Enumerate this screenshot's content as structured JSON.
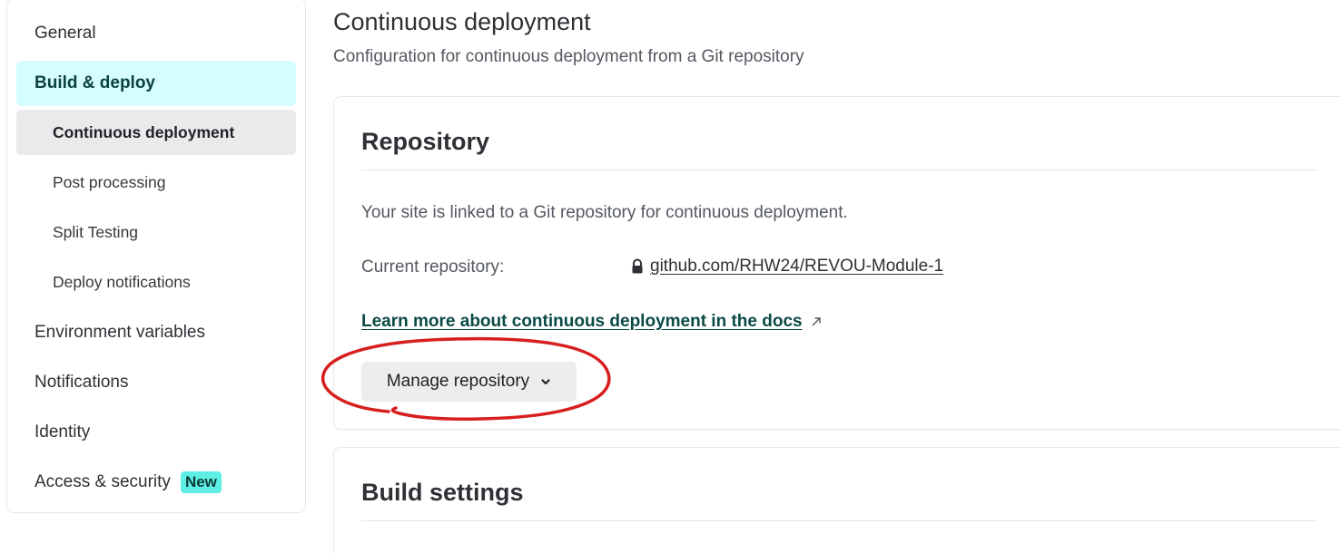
{
  "sidebar": {
    "items": [
      {
        "label": "General"
      },
      {
        "label": "Build & deploy"
      },
      {
        "label": "Continuous deployment"
      },
      {
        "label": "Post processing"
      },
      {
        "label": "Split Testing"
      },
      {
        "label": "Deploy notifications"
      },
      {
        "label": "Environment variables"
      },
      {
        "label": "Notifications"
      },
      {
        "label": "Identity"
      },
      {
        "label": "Access & security",
        "badge": "New"
      }
    ]
  },
  "main": {
    "title": "Continuous deployment",
    "subtitle": "Configuration for continuous deployment from a Git repository",
    "repository_card": {
      "title": "Repository",
      "description": "Your site is linked to a Git repository for continuous deployment.",
      "current_label": "Current repository:",
      "repo_link": "github.com/RHW24/REVOU-Module-1",
      "docs_link": "Learn more about continuous deployment in the docs",
      "manage_button": "Manage repository"
    },
    "build_card": {
      "title": "Build settings"
    }
  },
  "colors": {
    "active_parent_bg": "#d6fdfd",
    "active_child_bg": "#e9eaeb",
    "badge_bg": "#5eeee3",
    "link_teal": "#0a4a45",
    "annotation_red": "#d81f1f"
  },
  "icons": [
    "lock-icon",
    "external-link-icon",
    "chevron-down-icon"
  ]
}
